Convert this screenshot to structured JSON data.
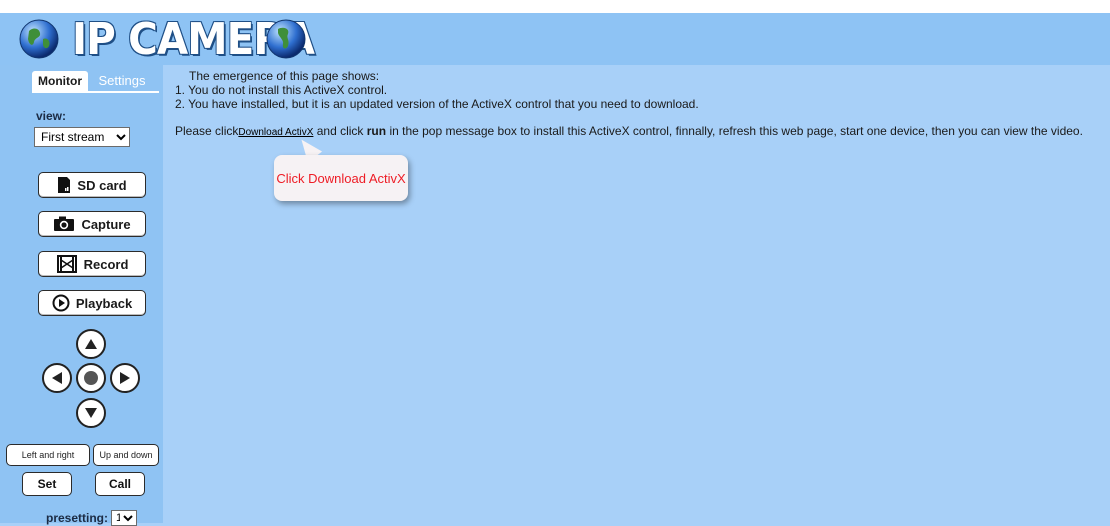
{
  "header": {
    "title": "IP CAMERA"
  },
  "sidebar": {
    "tabs": [
      "Monitor",
      "Settings"
    ],
    "view_label": "view:",
    "view_selected": "First stream",
    "buttons": {
      "sd_card": "SD card",
      "capture": "Capture",
      "record": "Record",
      "playback": "Playback"
    },
    "ptz": {
      "left_right": "Left and right",
      "up_down": "Up and down",
      "set": "Set",
      "call": "Call"
    },
    "presetting_label": "presetting:",
    "presetting_value": "1"
  },
  "main": {
    "line1": "The emergence of this page shows:",
    "line2": "1. You do not install this ActiveX control.",
    "line3": "2. You have installed, but it is an updated version of the ActiveX control that you need to download.",
    "instr_prefix": "Please click",
    "download_link": "Download ActivX",
    "instr_mid": " and click ",
    "instr_bold": "run",
    "instr_suffix": " in the pop message box to install this ActiveX control, finnally, refresh this web page, start one device, then you can view the video.",
    "tooltip": "Click Download ActivX"
  },
  "colors": {
    "background": "#a8d0f8",
    "header": "#8ec3f4",
    "sidebar": "#8fc3f3",
    "tooltip_text": "#ee1c25"
  }
}
